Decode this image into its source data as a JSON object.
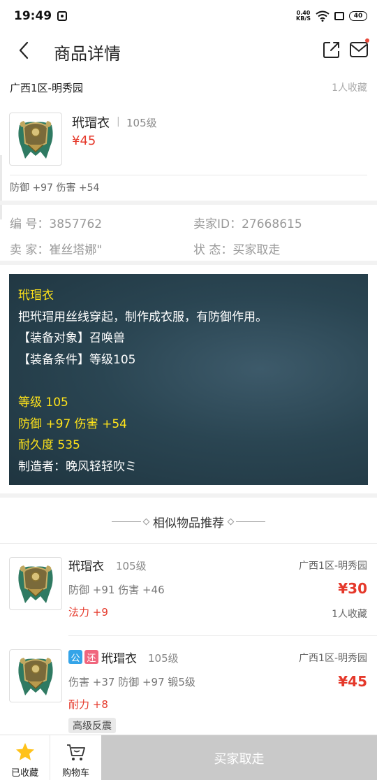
{
  "status_bar": {
    "time": "19:49",
    "net_speed_value": "0.40",
    "net_speed_unit": "KB/S",
    "battery": "40"
  },
  "nav": {
    "title": "商品详情"
  },
  "listing": {
    "server": "广西1区-明秀园",
    "fav_count": "1人收藏",
    "item_name": "玳瑁衣",
    "separator": "|",
    "level": "105级",
    "price": "¥45",
    "stats": "防御 +97 伤害 +54"
  },
  "info": {
    "id_label": "编  号：",
    "id_value": "3857762",
    "seller_id_label": "卖家ID：",
    "seller_id_value": "27668615",
    "seller_label": "卖  家：",
    "seller_value": "崔丝塔娜\"",
    "status_label": "状  态：",
    "status_value": "买家取走"
  },
  "description": {
    "lines": [
      {
        "text": "玳瑁衣",
        "color": "yellow"
      },
      {
        "text": "把玳瑁用丝线穿起，制作成衣服，有防御作用。",
        "color": "white"
      },
      {
        "text": "【装备对象】召唤兽",
        "color": "white"
      },
      {
        "text": "【装备条件】等级105",
        "color": "white"
      },
      {
        "text": "",
        "color": "white"
      },
      {
        "text": "等级 105",
        "color": "yellow"
      },
      {
        "text": "防御 +97 伤害 +54",
        "color": "yellow"
      },
      {
        "text": "耐久度 535",
        "color": "yellow"
      },
      {
        "text": "制造者：晚风轻轻吹ミ",
        "color": "white"
      }
    ],
    "colors": {
      "yellow": "#ffe31a",
      "white": "#ffffff",
      "panel_bg": "#2a4552"
    }
  },
  "recommendations": {
    "title": "相似物品推荐",
    "items": [
      {
        "name": "玳瑁衣",
        "level": "105级",
        "server": "广西1区-明秀园",
        "stats": "防御 +91 伤害 +46",
        "extra": "法力 +9",
        "price": "¥30",
        "fav": "1人收藏",
        "tags": []
      },
      {
        "name": "玳瑁衣",
        "level": "105级",
        "server": "广西1区-明秀园",
        "stats": "伤害 +37 防御 +97 锻5级",
        "extra": "耐力 +8",
        "price": "¥45",
        "badge": "高级反震",
        "tags": [
          "公",
          "还"
        ]
      }
    ]
  },
  "bottom_bar": {
    "fav_label": "已收藏",
    "cart_label": "购物车",
    "buy_label": "买家取走"
  },
  "accent_colors": {
    "price_red": "#e5392b",
    "tag_blue": "#34a4e8",
    "tag_red": "#f0667d",
    "star_yellow": "#ffc21a"
  }
}
